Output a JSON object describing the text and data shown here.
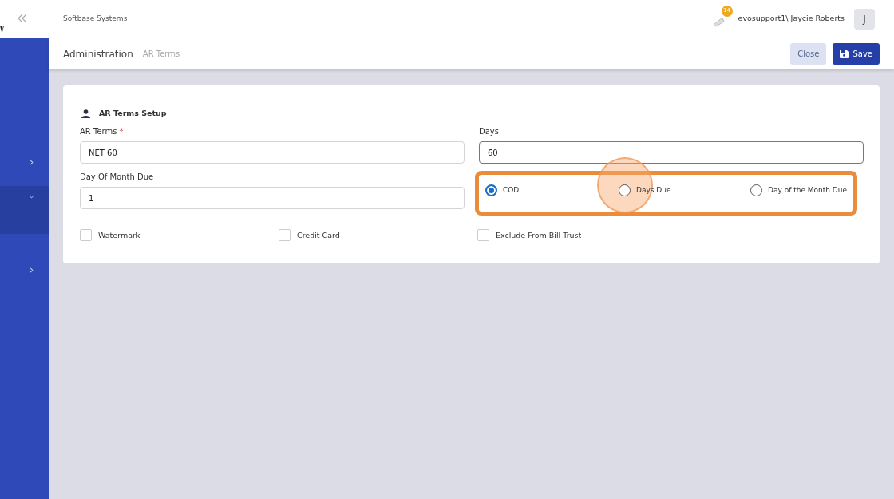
{
  "topbar": {
    "company": "Softbase Systems",
    "notification_count": "14",
    "user": "evosupport1\\ Jaycie Roberts",
    "avatar_initial": "J"
  },
  "sidebar": {
    "items": [
      {
        "expanded": false,
        "selected": false
      },
      {
        "expanded": true,
        "selected": true
      },
      {
        "expanded": false,
        "selected": false
      }
    ]
  },
  "header": {
    "title": "Administration",
    "breadcrumb": "AR Terms",
    "buttons": [
      {
        "kind": "secondary",
        "label": "Close"
      },
      {
        "kind": "primary",
        "label": "Save"
      }
    ]
  },
  "form": {
    "title": "AR Terms Setup",
    "fields": [
      {
        "label": "AR Terms",
        "required_mark": "*",
        "value": "NET 60",
        "focused": false
      },
      {
        "label": "Days",
        "value": "60",
        "focused": true
      },
      {
        "label": "Day Of Month Due",
        "value": "1",
        "focused": false
      }
    ],
    "radios": [
      {
        "label": "COD",
        "selected": true,
        "clicked": false
      },
      {
        "label": "Days Due",
        "selected": false,
        "clicked": true
      },
      {
        "label": "Day of the Month Due",
        "selected": false,
        "clicked": false
      }
    ],
    "radio_highlight": true,
    "checkboxes": [
      {
        "label": "Watermark",
        "checked": false
      },
      {
        "label": "Credit Card",
        "checked": false
      },
      {
        "label": "Exclude From Bill Trust",
        "checked": false
      }
    ]
  }
}
